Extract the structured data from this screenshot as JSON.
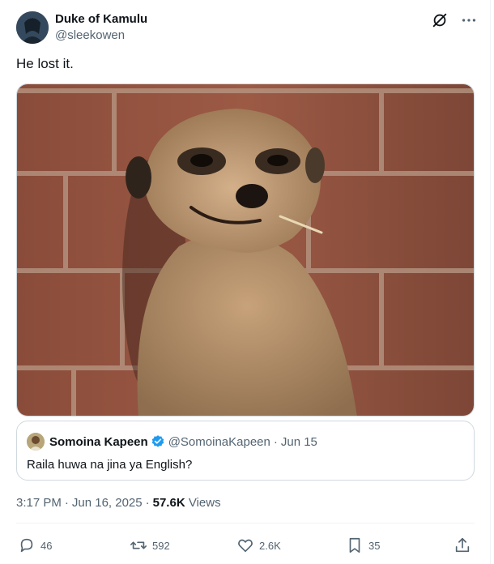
{
  "author": {
    "display_name": "Duke of Kamulu",
    "handle": "@sleekowen",
    "avatar_icon": "profile-avatar"
  },
  "tweet": {
    "text": "He lost it.",
    "media_icon": "meerkat-photo"
  },
  "quote": {
    "display_name": "Somoina Kapeen",
    "verified": true,
    "handle": "@SomoinaKapeen",
    "separator": "·",
    "date": "Jun 15",
    "text": "Raila huwa na jina ya English?"
  },
  "meta": {
    "time": "3:17 PM",
    "separator": "·",
    "date": "Jun 16, 2025",
    "views_count": "57.6K",
    "views_label": "Views"
  },
  "actions": {
    "replies": "46",
    "reposts": "592",
    "likes": "2.6K",
    "bookmarks": "35"
  },
  "colors": {
    "text": "#0f1419",
    "secondary": "#536471",
    "border": "#cfd9de",
    "verified": "#1d9bf0"
  }
}
